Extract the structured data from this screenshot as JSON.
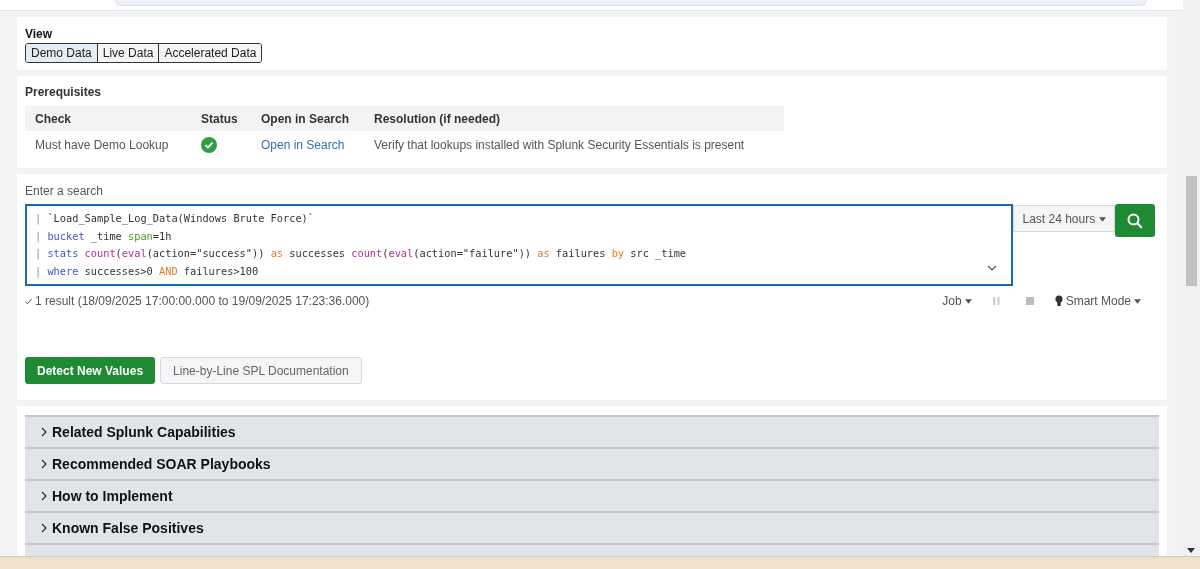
{
  "view": {
    "title": "View",
    "options": [
      {
        "label": "Demo Data",
        "selected": true
      },
      {
        "label": "Live Data",
        "selected": false
      },
      {
        "label": "Accelerated Data",
        "selected": false
      }
    ]
  },
  "prerequisites": {
    "title": "Prerequisites",
    "columns": [
      "Check",
      "Status",
      "Open in Search",
      "Resolution (if needed)"
    ],
    "rows": [
      {
        "check": "Must have Demo Lookup",
        "passed": true,
        "link": "Open in Search",
        "resolution": "Verify that lookups installed with Splunk Security Essentials is present"
      }
    ]
  },
  "search": {
    "label": "Enter a search",
    "lines": [
      [
        {
          "kind": "pipe",
          "text": "| "
        },
        {
          "kind": "plain",
          "text": "`Load_Sample_Log_Data(Windows Brute Force)`"
        }
      ],
      [
        {
          "kind": "pipe",
          "text": "| "
        },
        {
          "kind": "command",
          "text": "bucket"
        },
        {
          "kind": "plain",
          "text": " _time "
        },
        {
          "kind": "arg",
          "text": "span"
        },
        {
          "kind": "plain",
          "text": "=1h"
        }
      ],
      [
        {
          "kind": "pipe",
          "text": "| "
        },
        {
          "kind": "command",
          "text": "stats "
        },
        {
          "kind": "function",
          "text": "count"
        },
        {
          "kind": "plain",
          "text": "("
        },
        {
          "kind": "function",
          "text": "eval"
        },
        {
          "kind": "plain",
          "text": "(action=\"success\")) "
        },
        {
          "kind": "keyword",
          "text": "as"
        },
        {
          "kind": "plain",
          "text": " successes "
        },
        {
          "kind": "function",
          "text": "count"
        },
        {
          "kind": "plain",
          "text": "("
        },
        {
          "kind": "function",
          "text": "eval"
        },
        {
          "kind": "plain",
          "text": "(action=\"failure\")) "
        },
        {
          "kind": "keyword",
          "text": "as"
        },
        {
          "kind": "plain",
          "text": " failures "
        },
        {
          "kind": "keyword",
          "text": "by"
        },
        {
          "kind": "plain",
          "text": " src _time"
        }
      ],
      [
        {
          "kind": "pipe",
          "text": "| "
        },
        {
          "kind": "command",
          "text": "where"
        },
        {
          "kind": "plain",
          "text": " successes>0 "
        },
        {
          "kind": "keyword",
          "text": "AND"
        },
        {
          "kind": "plain",
          "text": " failures>100"
        }
      ]
    ],
    "time_range": "Last 24 hours",
    "result": "1 result (18/09/2025 17:00:00.000 to 19/09/2025 17:23:36.000)",
    "job": "Job",
    "mode": "Smart Mode"
  },
  "actions": [
    {
      "label": "Detect New Values",
      "kind": "primary"
    },
    {
      "label": "Line-by-Line SPL Documentation",
      "kind": "secondary"
    }
  ],
  "sections": [
    {
      "title": "Related Splunk Capabilities",
      "expanded": false
    },
    {
      "title": "Recommended SOAR Playbooks",
      "expanded": false
    },
    {
      "title": "How to Implement",
      "expanded": false
    },
    {
      "title": "Known False Positives",
      "expanded": false
    }
  ]
}
